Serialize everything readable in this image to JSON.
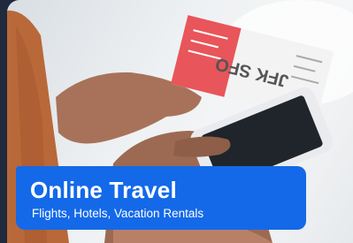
{
  "banner": {
    "title": "Online Travel",
    "subtitle": "Flights, Hotels, Vacation Rentals"
  },
  "photo": {
    "ticket_text": "JFK SFO"
  },
  "colors": {
    "page_background": "#1f2a3d",
    "banner_background": "#1469e8",
    "banner_text": "#ffffff",
    "ticket_red": "#e8555a"
  }
}
